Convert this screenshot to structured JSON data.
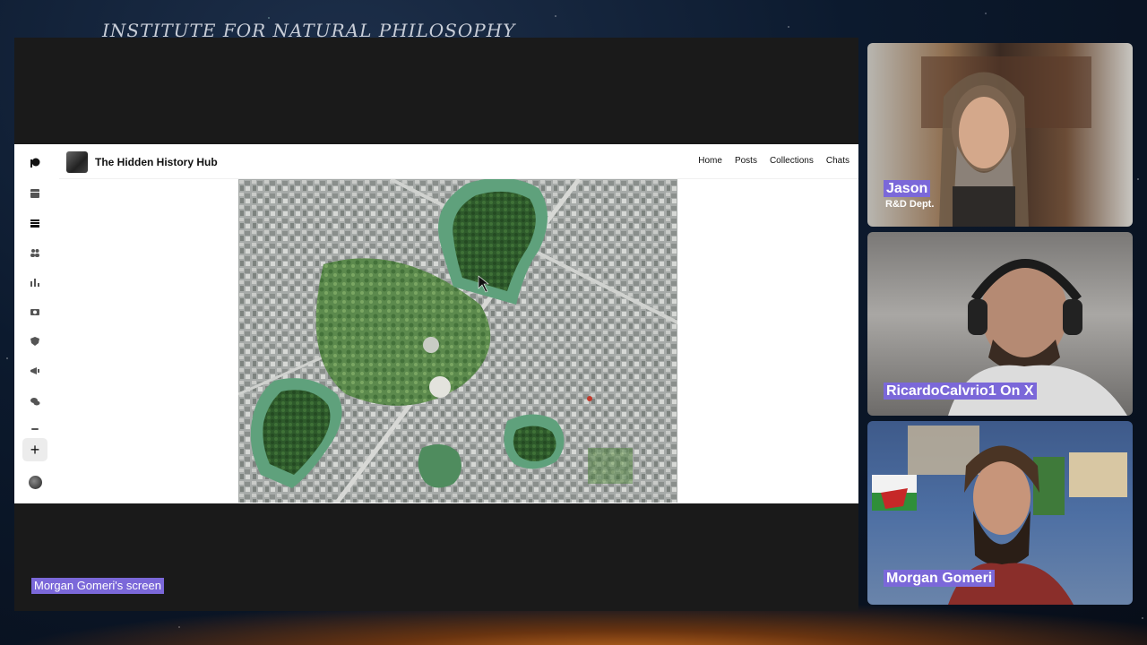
{
  "background": {
    "brand_title": "INSTITUTE FOR NATURAL PHILOSOPHY",
    "colors": {
      "accent": "#7b68d9",
      "stage": "#1a1a1a"
    }
  },
  "screen_share": {
    "label": "Morgan Gomeri's screen",
    "browser_page": {
      "site_name": "The Hidden History Hub",
      "nav": [
        "Home",
        "Posts",
        "Collections",
        "Chats"
      ],
      "sidebar_icons": [
        "logo-icon",
        "dashboard-icon",
        "library-icon",
        "members-icon",
        "analytics-icon",
        "payouts-icon",
        "security-icon",
        "announcements-icon",
        "chats-icon",
        "more-icon"
      ],
      "sidebar_add": "+",
      "image_description": "aerial-map-keyhole-tombs"
    }
  },
  "participants": [
    {
      "name": "Jason",
      "subtitle": "R&D Dept."
    },
    {
      "name": "RicardoCalvrio1 On X",
      "subtitle": ""
    },
    {
      "name": "Morgan Gomeri",
      "subtitle": ""
    }
  ]
}
